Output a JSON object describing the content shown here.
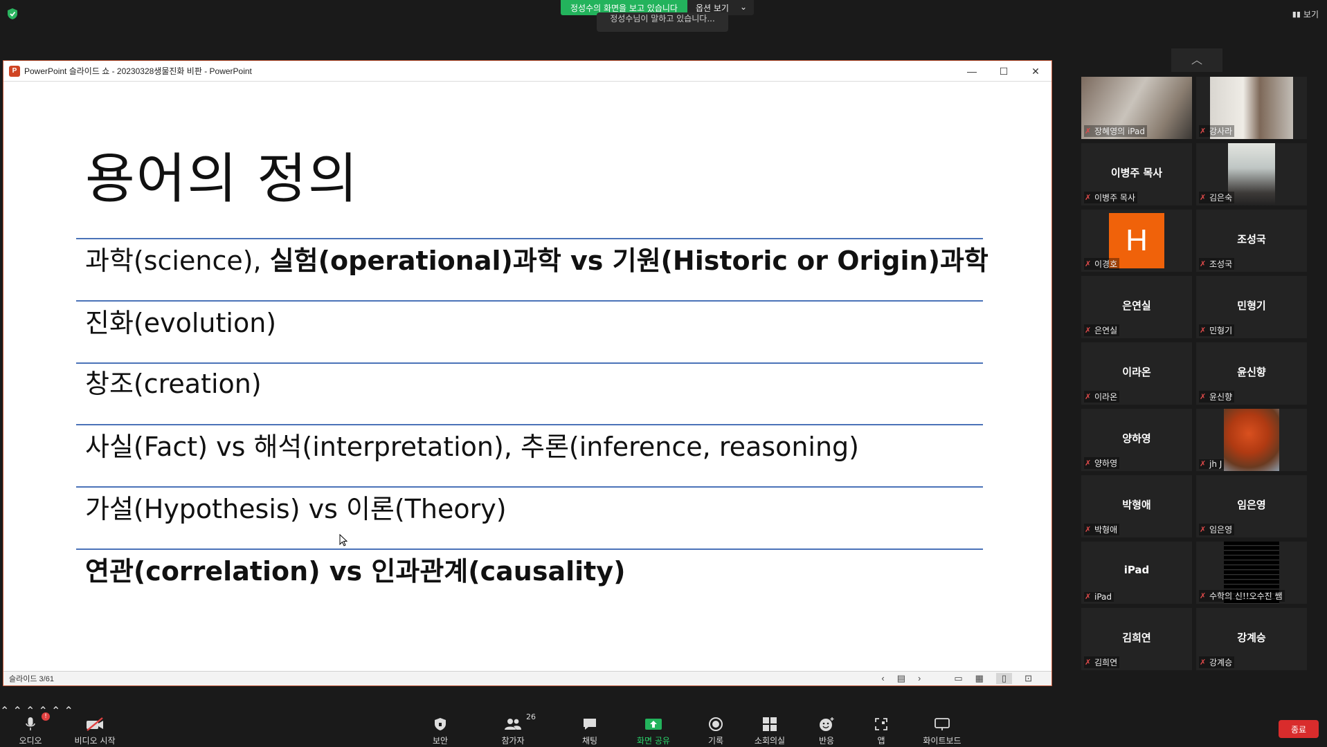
{
  "top": {
    "share_text": "정성수의 화면을 보고 있습니다",
    "view_options": "옵션 보기",
    "speaking_tip": "정성수님이 말하고 있습니다...",
    "view_label": "보기"
  },
  "ppt": {
    "window_title": "PowerPoint 슬라이드 쇼  -  20230328생물진화 비판 - PowerPoint",
    "slide": {
      "title": "용어의 정의",
      "items": [
        {
          "normal": "과학(science), ",
          "bold": "실험(operational)과학 vs 기원(Historic or Origin)과학"
        },
        {
          "normal": "진화(evolution)",
          "bold": ""
        },
        {
          "normal": "창조(creation)",
          "bold": ""
        },
        {
          "normal": "사실(Fact) vs 해석(interpretation), 추론(inference, reasoning)",
          "bold": ""
        },
        {
          "normal": "가설(Hypothesis) vs 이론(Theory)",
          "bold": ""
        },
        {
          "normal": "",
          "bold": "연관(correlation) vs 인과관계(causality)"
        }
      ]
    },
    "status": "슬라이드 3/61"
  },
  "gallery": {
    "tiles": [
      {
        "name": "장혜영의 iPad",
        "video": true
      },
      {
        "name": "강사라",
        "video": true
      },
      {
        "name": "이병주 목사",
        "center": "이병주 목사"
      },
      {
        "name": "김은숙",
        "video": true
      },
      {
        "name": "이경호",
        "avatar": "H"
      },
      {
        "name": "조성국",
        "center": "조성국"
      },
      {
        "name": "은연실",
        "center": "은연실"
      },
      {
        "name": "민형기",
        "center": "민형기"
      },
      {
        "name": "이라온",
        "center": "이라온"
      },
      {
        "name": "윤신향",
        "center": "윤신향"
      },
      {
        "name": "양하영",
        "center": "양하영"
      },
      {
        "name": "jh J",
        "video": true
      },
      {
        "name": "박형애",
        "center": "박형애"
      },
      {
        "name": "임은영",
        "center": "임은영"
      },
      {
        "name": "iPad",
        "center": "iPad"
      },
      {
        "name": "수학의 신!!오수진 쌤",
        "video": true
      },
      {
        "name": "김희연",
        "center": "김희연"
      },
      {
        "name": "강계승",
        "center": "강계승"
      }
    ]
  },
  "toolbar": {
    "audio": "오디오",
    "video": "비디오 시작",
    "security": "보안",
    "participants": "참가자",
    "participants_count": "26",
    "chat": "채팅",
    "share": "화면 공유",
    "record": "기록",
    "breakout": "소회의실",
    "reactions": "반응",
    "apps": "앱",
    "whiteboard": "화이트보드",
    "end": "종료"
  },
  "colors": {
    "share_green": "#23b35c",
    "slide_rule": "#4a72b8",
    "end_red": "#d92c2c",
    "avatar_orange": "#f0620a"
  }
}
